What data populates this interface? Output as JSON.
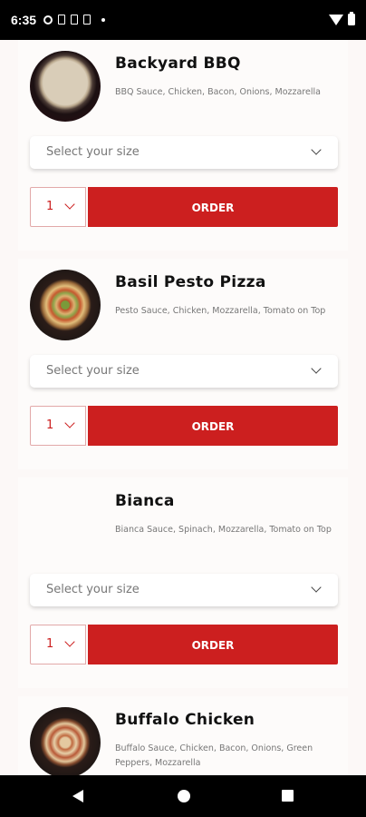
{
  "status_bar": {
    "time": "6:35",
    "icons": [
      "gear-icon",
      "document-icon",
      "document-icon",
      "sim-icon",
      "dot-icon",
      "wifi-icon",
      "battery-icon"
    ]
  },
  "colors": {
    "accent": "#cc1f1f",
    "background": "#fcf8f7"
  },
  "menu": {
    "items": [
      {
        "name": "Backyard BBQ",
        "description": "BBQ Sauce, Chicken, Bacon, Onions, Mozzarella",
        "size_placeholder": "Select your size",
        "quantity": "1",
        "order_label": "ORDER"
      },
      {
        "name": "Basil Pesto Pizza",
        "description": "Pesto Sauce, Chicken, Mozzarella, Tomato on Top",
        "size_placeholder": "Select your size",
        "quantity": "1",
        "order_label": "ORDER"
      },
      {
        "name": "Bianca",
        "description": "Bianca Sauce, Spinach, Mozzarella, Tomato on Top",
        "size_placeholder": "Select your size",
        "quantity": "1",
        "order_label": "ORDER"
      },
      {
        "name": "Buffalo Chicken",
        "description": "Buffalo Sauce, Chicken, Bacon, Onions, Green Peppers, Mozzarella"
      }
    ]
  }
}
